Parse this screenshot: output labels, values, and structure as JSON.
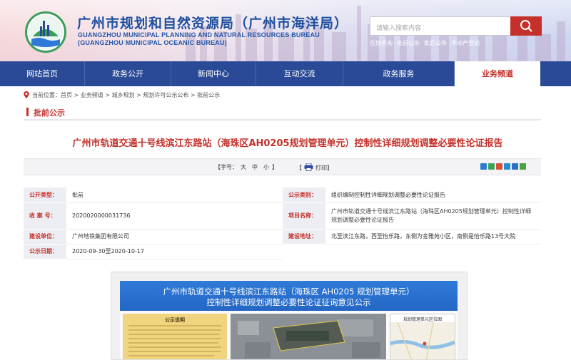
{
  "header": {
    "title_cn": "广州市规划和自然资源局（广州市海洋局）",
    "title_en_line1": "GUANGZHOU MUNICIPAL PLANNING AND NATURAL RESOURCES BUREAU",
    "title_en_line2": "(GUANGZHOU MUNICIPAL OCEANIC BUREAU)",
    "search_placeholder": "请输入搜索内容",
    "quick_links": [
      "在线咨询",
      "批前公示",
      "批后公布",
      "不动产登记"
    ],
    "brand_red": "#c4312b",
    "brand_blue": "#2a4a97"
  },
  "nav": {
    "items": [
      {
        "label": "网站首页",
        "active": false
      },
      {
        "label": "政务公开",
        "active": false
      },
      {
        "label": "新闻中心",
        "active": false
      },
      {
        "label": "互动交流",
        "active": false
      },
      {
        "label": "政务服务",
        "active": false
      },
      {
        "label": "业务频道",
        "active": true
      }
    ]
  },
  "breadcrumb": {
    "prefix": "当前位置：",
    "items": [
      "首页",
      "业务频道",
      "城乡规划",
      "规划许可公示公布",
      "批前公示"
    ],
    "separator": " > "
  },
  "section": {
    "label": "批前公示"
  },
  "document": {
    "title": "广州市轨道交通十号线滨江东路站（海珠区AH0205规划管理单元）控制性详细规划调整必要性论证报告"
  },
  "tools": {
    "font_label_prefix": "【字号：",
    "font_sizes": [
      "大",
      "中",
      "小"
    ],
    "font_label_suffix": "】",
    "print_prefix": "【",
    "print_label": "打印",
    "print_suffix": "】",
    "share_icon_colors": [
      "#2a7bd0",
      "#3aa655",
      "#d8503a",
      "#1f8fd8",
      "#2f6fc2",
      "#48a23f"
    ]
  },
  "info": {
    "rows": [
      [
        {
          "key": "公开类型：",
          "value": "批前"
        },
        {
          "key": "公示类别：",
          "value": "组织编制控制性详细规划调整必要性论证报告"
        }
      ],
      [
        {
          "key": "收 案 号：",
          "value": "2020020000031736"
        },
        {
          "key": "项目名称：",
          "value": "广州市轨道交通十号线滨江东路站（海珠区AH0205规划管理单元）控制性详细规划调整必要性论证报告"
        }
      ],
      [
        {
          "key": "建设单位：",
          "value": "广州地铁集团有限公司"
        },
        {
          "key": "建设地址：",
          "value": "北至滨江东路，西至怡乐路，东侧为金雅苑小区，南侧是怡乐路13号大院"
        }
      ],
      [
        {
          "key": "公示日期：",
          "value": "2020-09-30至2020-10-17"
        }
      ]
    ]
  },
  "notice": {
    "banner_line1": "广州市轨道交通十号线滨江东路站（海珠区 AH0205 规划管理单元）",
    "banner_line2": "控制性详细规划调整必要性论证征询意见公示",
    "left_header": "公示说明",
    "map_header": "规划管理单元区位图"
  }
}
